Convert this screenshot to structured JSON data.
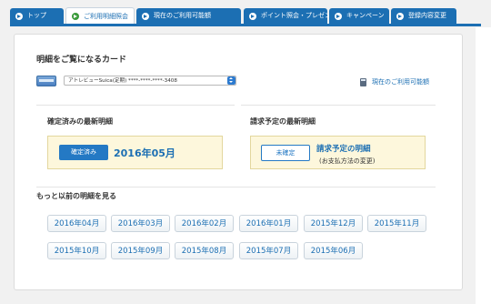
{
  "tabs": [
    {
      "label": "トップ",
      "active": false
    },
    {
      "label": "ご利用明細照会",
      "active": true
    },
    {
      "label": "現在のご利用可能額",
      "active": false
    },
    {
      "label": "ポイント照会・プレゼント申込",
      "active": false
    },
    {
      "label": "キャンペーン",
      "active": false
    },
    {
      "label": "登録内容変更",
      "active": false
    }
  ],
  "page": {
    "title": "明細をご覧になるカード",
    "card_select_value": "アトレビューSuica(定期)  ****-****-****-3408",
    "available_link": "現在のご利用可能額"
  },
  "confirmed": {
    "heading": "確定済みの最新明細",
    "badge": "確定済み",
    "month": "2016年05月"
  },
  "pending": {
    "heading": "請求予定の最新明細",
    "badge": "未確定",
    "link": "請求予定の明細",
    "sub": "(お支払方法の変更)"
  },
  "history": {
    "heading": "もっと以前の明細を見る",
    "months": [
      "2016年04月",
      "2016年03月",
      "2016年02月",
      "2016年01月",
      "2015年12月",
      "2015年11月",
      "2015年10月",
      "2015年09月",
      "2015年08月",
      "2015年07月",
      "2015年06月"
    ]
  }
}
